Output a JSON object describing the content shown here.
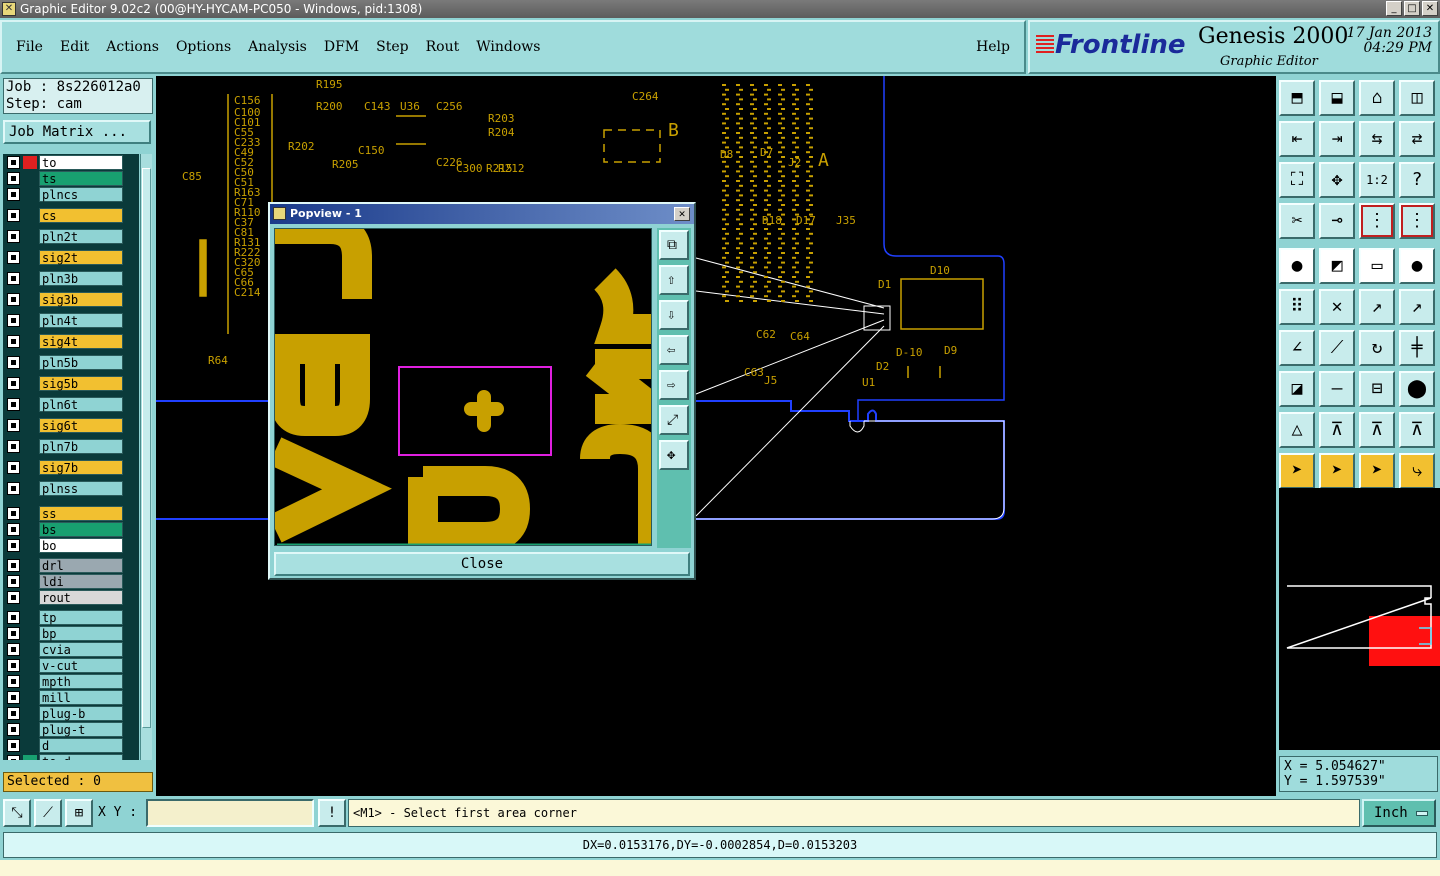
{
  "window": {
    "title": "Graphic Editor 9.02c2 (00@HY-HYCAM-PC050 - Windows, pid:1308)"
  },
  "menu": [
    "File",
    "Edit",
    "Actions",
    "Options",
    "Analysis",
    "DFM",
    "Step",
    "Rout",
    "Windows"
  ],
  "help_label": "Help",
  "brand": {
    "logo": "Frontline",
    "product": "Genesis 2000",
    "subtitle": "Graphic Editor",
    "date": "17 Jan 2013",
    "time": "04:29 PM"
  },
  "job": {
    "job_line": "Job : 8s226012a0",
    "step_line": "Step: cam",
    "matrix_button": "Job Matrix ..."
  },
  "layers": [
    {
      "name": "to",
      "bg": "#ffffff",
      "swatch": "#e02020",
      "sw2": "#1a2a9a"
    },
    {
      "name": "ts",
      "bg": "#18a070",
      "swatch": "#0a3a3a"
    },
    {
      "name": "plncs",
      "bg": "#8fd3d3",
      "swatch": "#0a3a3a"
    },
    {
      "name": "cs",
      "bg": "#f2c030",
      "swatch": "#0a3a3a"
    },
    {
      "name": "pln2t",
      "bg": "#8fd3d3",
      "swatch": "#0a3a3a"
    },
    {
      "name": "sig2t",
      "bg": "#f2c030",
      "swatch": "#0a3a3a"
    },
    {
      "name": "pln3b",
      "bg": "#8fd3d3",
      "swatch": "#0a3a3a"
    },
    {
      "name": "sig3b",
      "bg": "#f2c030",
      "swatch": "#0a3a3a"
    },
    {
      "name": "pln4t",
      "bg": "#8fd3d3",
      "swatch": "#0a3a3a"
    },
    {
      "name": "sig4t",
      "bg": "#f2c030",
      "swatch": "#0a3a3a"
    },
    {
      "name": "pln5b",
      "bg": "#8fd3d3",
      "swatch": "#0a3a3a"
    },
    {
      "name": "sig5b",
      "bg": "#f2c030",
      "swatch": "#0a3a3a"
    },
    {
      "name": "pln6t",
      "bg": "#8fd3d3",
      "swatch": "#0a3a3a"
    },
    {
      "name": "sig6t",
      "bg": "#f2c030",
      "swatch": "#0a3a3a"
    },
    {
      "name": "pln7b",
      "bg": "#8fd3d3",
      "swatch": "#0a3a3a"
    },
    {
      "name": "sig7b",
      "bg": "#f2c030",
      "swatch": "#0a3a3a"
    },
    {
      "name": "plnss",
      "bg": "#8fd3d3",
      "swatch": "#0a3a3a"
    },
    {
      "name": "ss",
      "bg": "#f2c030",
      "swatch": "#0a3a3a"
    },
    {
      "name": "bs",
      "bg": "#18a070",
      "swatch": "#0a3a3a"
    },
    {
      "name": "bo",
      "bg": "#ffffff",
      "swatch": "#0a3a3a"
    },
    {
      "name": "drl",
      "bg": "#9aa8b0",
      "swatch": "#0a3a3a"
    },
    {
      "name": "ldi",
      "bg": "#9aa8b0",
      "swatch": "#0a3a3a"
    },
    {
      "name": "rout",
      "bg": "#d8d8d8",
      "swatch": "#0a3a3a"
    },
    {
      "name": "tp",
      "bg": "#8fd3d3",
      "swatch": "#0a3a3a"
    },
    {
      "name": "bp",
      "bg": "#8fd3d3",
      "swatch": "#0a3a3a"
    },
    {
      "name": "cvia",
      "bg": "#8fd3d3",
      "swatch": "#0a3a3a"
    },
    {
      "name": "v-cut",
      "bg": "#8fd3d3",
      "swatch": "#0a3a3a"
    },
    {
      "name": "mpth",
      "bg": "#8fd3d3",
      "swatch": "#0a3a3a"
    },
    {
      "name": "mill",
      "bg": "#8fd3d3",
      "swatch": "#0a3a3a"
    },
    {
      "name": "plug-b",
      "bg": "#8fd3d3",
      "swatch": "#0a3a3a"
    },
    {
      "name": "plug-t",
      "bg": "#8fd3d3",
      "swatch": "#0a3a3a"
    },
    {
      "name": "d",
      "bg": "#8fd3d3",
      "swatch": "#0a3a3a"
    },
    {
      "name": "to_d",
      "bg": "#8fd3d3",
      "swatch": "#18a070"
    }
  ],
  "selected_label": "Selected : 0",
  "popview": {
    "title": "Popview - 1",
    "close_label": "Close",
    "tools": [
      "zoom-window-icon",
      "pan-up-icon",
      "pan-down-icon",
      "pan-left-icon",
      "pan-right-icon",
      "zoom-fit-icon",
      "zoom-home-icon"
    ]
  },
  "canvas_labels": [
    "R195",
    "R200",
    "C143",
    "U36",
    "C256",
    "C264",
    "R203",
    "R204",
    "R202",
    "C150",
    "R205",
    "C226",
    "C300",
    "R215",
    "R212",
    "C85",
    "C156",
    "C100",
    "C101",
    "C55",
    "C233",
    "C49",
    "C52",
    "C50",
    "C51",
    "R163",
    "C71",
    "R110",
    "C37",
    "C81",
    "R131",
    "R222",
    "C320",
    "C65",
    "C66",
    "C214",
    "R64",
    "C63",
    "C62",
    "C64",
    "J5",
    "D-10",
    "U1",
    "D2",
    "D1",
    "D10",
    "D9",
    "D8",
    "D7",
    "D18",
    "D17",
    "J35",
    "J2",
    "A",
    "B"
  ],
  "coords": {
    "x_line": "X = 5.054627\"",
    "y_line": "Y = 1.597539\""
  },
  "bottom": {
    "xy_label": "X Y :",
    "xy_value": "",
    "message": "<M1> - Select first area corner",
    "unit": "Inch"
  },
  "status": "DX=0.0153176,DY=-0.0002854,D=0.0153203",
  "colors": {
    "panel": "#8fd3d3",
    "canvas": "#000000",
    "copper": "#c8a000",
    "outline": "#ffffff",
    "route": "#2040ff",
    "highlight": "#e020e0"
  },
  "toolbar_icons": [
    "screen-top-icon",
    "screen-bottom-icon",
    "home-icon",
    "split-window-icon",
    "edge-left-icon",
    "edge-right-icon",
    "flip-icon",
    "mirror-icon",
    "fit-icon",
    "center-icon",
    "scale-1-2-icon",
    "query-icon",
    "measure-icon",
    "snap-pad-icon",
    "net-highlight-icon",
    "net-compare-icon",
    "pad-select-icon",
    "drc-icon",
    "ruler-icon",
    "dot-icon",
    "connect-icon",
    "cross-icon",
    "line-arrow-icon",
    "line-arrow-2-icon",
    "angle-icon",
    "slash-icon",
    "arc-icon",
    "symbol-icon",
    "feature-icon",
    "minus-icon",
    "grid-icon",
    "blob-icon",
    "triangle-icon",
    "triangle-a-icon",
    "triangle-b-icon",
    "triangle-c-icon",
    "pointer-icon",
    "pointer-box-icon",
    "pointer-red-icon",
    "route-pointer-icon"
  ]
}
